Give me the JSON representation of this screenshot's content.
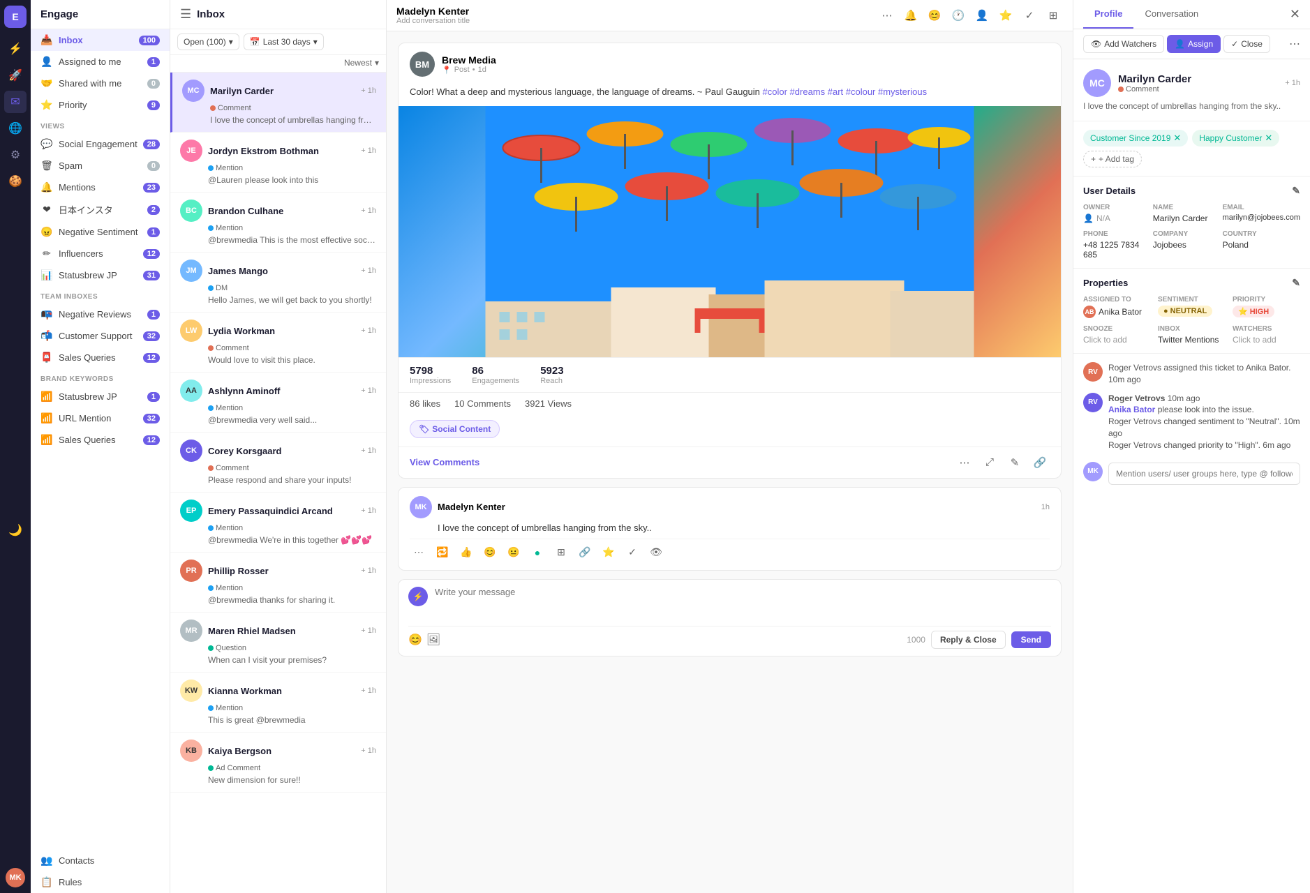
{
  "app": {
    "name": "Engage",
    "logo": "E"
  },
  "iconBar": {
    "items": [
      {
        "name": "navigate-icon",
        "icon": "⚡",
        "active": false
      },
      {
        "name": "rocket-icon",
        "icon": "🚀",
        "active": false
      },
      {
        "name": "inbox-icon",
        "icon": "✉",
        "active": true
      },
      {
        "name": "globe-icon",
        "icon": "🌐",
        "active": false
      },
      {
        "name": "settings-icon",
        "icon": "⚙",
        "active": false
      },
      {
        "name": "cookie-icon",
        "icon": "🍪",
        "active": false
      },
      {
        "name": "moon-icon",
        "icon": "🌙",
        "active": false
      }
    ],
    "avatar": "MK"
  },
  "sidebar": {
    "header": "Engage",
    "mainItems": [
      {
        "label": "Inbox",
        "icon": "📥",
        "badge": "100",
        "badgeColor": "purple",
        "active": true
      },
      {
        "label": "Assigned to me",
        "icon": "👤",
        "badge": "1",
        "badgeColor": "purple"
      },
      {
        "label": "Shared with me",
        "icon": "🤝",
        "badge": "0",
        "badgeColor": "gray"
      },
      {
        "label": "Priority",
        "icon": "⭐",
        "badge": "9",
        "badgeColor": "purple"
      }
    ],
    "viewsLabel": "VIEWS",
    "viewItems": [
      {
        "label": "Social Engagement",
        "icon": "💬",
        "badge": "28"
      },
      {
        "label": "Spam",
        "icon": "🗑",
        "badge": "0"
      },
      {
        "label": "Mentions",
        "icon": "🔔",
        "badge": "23"
      },
      {
        "label": "日本インスタ",
        "icon": "❤",
        "badge": "2"
      },
      {
        "label": "Negative Sentiment",
        "icon": "😠",
        "badge": "1"
      },
      {
        "label": "Influencers",
        "icon": "✏",
        "badge": "12"
      },
      {
        "label": "Statusbrew JP",
        "icon": "📊",
        "badge": "31"
      }
    ],
    "teamInboxLabel": "TEAM INBOXES",
    "teamItems": [
      {
        "label": "Negative Reviews",
        "icon": "📭",
        "badge": "1"
      },
      {
        "label": "Customer Support",
        "icon": "📬",
        "badge": "32"
      },
      {
        "label": "Sales Queries",
        "icon": "📮",
        "badge": "12"
      }
    ],
    "brandLabel": "BRAND KEYWORDS",
    "brandItems": [
      {
        "label": "Statusbrew JP",
        "icon": "📶",
        "badge": "1"
      },
      {
        "label": "URL Mention",
        "icon": "📶",
        "badge": "32"
      },
      {
        "label": "Sales Queries",
        "icon": "📶",
        "badge": "12"
      }
    ],
    "bottomItems": [
      {
        "label": "Contacts",
        "icon": "👥"
      },
      {
        "label": "Rules",
        "icon": "📋"
      }
    ]
  },
  "inbox": {
    "title": "Inbox",
    "filterOpen": "Open (100)",
    "filterDate": "Last 30 days",
    "sortLabel": "Newest",
    "items": [
      {
        "name": "Marilyn Carder",
        "type": "Comment",
        "typeColor": "#e17055",
        "time": "+ 1h",
        "preview": "I love the concept of umbrellas hanging from the sky...",
        "avatarBg": "#a29bfe",
        "initials": "MC",
        "active": true
      },
      {
        "name": "Jordyn Ekstrom Bothman",
        "type": "Mention",
        "typeColor": "#1da1f2",
        "time": "+ 1h",
        "preview": "@Lauren please look into this",
        "avatarBg": "#fd79a8",
        "initials": "JE"
      },
      {
        "name": "Brandon Culhane",
        "type": "Mention",
        "typeColor": "#1da1f2",
        "time": "+ 1h",
        "preview": "@brewmedia This is the most effective social media tips for...",
        "avatarBg": "#55efc4",
        "initials": "BC"
      },
      {
        "name": "James Mango",
        "type": "DM",
        "typeColor": "#1da1f2",
        "time": "+ 1h",
        "preview": "Hello James, we will get back to you shortly!",
        "avatarBg": "#74b9ff",
        "initials": "JM"
      },
      {
        "name": "Lydia Workman",
        "type": "Comment",
        "typeColor": "#e17055",
        "time": "+ 1h",
        "preview": "Would love to visit this place.",
        "avatarBg": "#fdcb6e",
        "initials": "LW"
      },
      {
        "name": "Ashlynn Aminoff",
        "type": "Mention",
        "typeColor": "#1da1f2",
        "time": "+ 1h",
        "preview": "@brewmedia very well said...",
        "avatarBg": "#81ecec",
        "initials": "AA"
      },
      {
        "name": "Corey Korsgaard",
        "type": "Comment",
        "typeColor": "#e17055",
        "time": "+ 1h",
        "preview": "Please respond and share your inputs!",
        "avatarBg": "#6c5ce7",
        "initials": "CK"
      },
      {
        "name": "Emery Passaquindici Arcand",
        "type": "Mention",
        "typeColor": "#1da1f2",
        "time": "+ 1h",
        "preview": "@brewmedia We're in this together 💕💕💕",
        "avatarBg": "#00cec9",
        "initials": "EP"
      },
      {
        "name": "Phillip Rosser",
        "type": "Mention",
        "typeColor": "#1da1f2",
        "time": "+ 1h",
        "preview": "@brewmedia thanks for sharing it.",
        "avatarBg": "#e17055",
        "initials": "PR"
      },
      {
        "name": "Maren Rhiel Madsen",
        "type": "Question",
        "typeColor": "#00b894",
        "time": "+ 1h",
        "preview": "When can I visit your premises?",
        "avatarBg": "#b2bec3",
        "initials": "MR"
      },
      {
        "name": "Kianna Workman",
        "type": "Mention",
        "typeColor": "#1da1f2",
        "time": "+ 1h",
        "preview": "This is great @brewmedia",
        "avatarBg": "#ffeaa7",
        "initials": "KW"
      },
      {
        "name": "Kaiya Bergson",
        "type": "Ad Comment",
        "typeColor": "#00b894",
        "time": "+ 1h",
        "preview": "New dimension for sure!!",
        "avatarBg": "#fab1a0",
        "initials": "KB"
      }
    ]
  },
  "conversation": {
    "headerName": "Madelyn Kenter",
    "headerSub": "Add conversation title",
    "post": {
      "source": "Brew Media",
      "sourceType": "Post",
      "sourceMeta": "1d",
      "avatarBg": "#636e72",
      "avatarInitials": "BM",
      "text": "Color! What a deep and mysterious language, the language of dreams. ~ Paul Gauguin",
      "hashtags": [
        "#color",
        "#dreams",
        "#art",
        "#colour",
        "#mysterious"
      ],
      "stats": {
        "impressions": "5798",
        "impressionsLabel": "Impressions",
        "engagements": "86",
        "engagementsLabel": "Engagements",
        "reach": "5923",
        "reachLabel": "Reach"
      },
      "likes": "86 likes",
      "comments": "10 Comments",
      "views": "3921 Views",
      "tagLabel": "Social Content"
    },
    "comment": {
      "authorName": "Madelyn Kenter",
      "authorAvatarBg": "#a29bfe",
      "authorInitials": "MK",
      "time": "1h",
      "text": "I love the concept of umbrellas hanging from the sky.."
    },
    "compose": {
      "placeholder": "Write your message",
      "charCount": "1000",
      "replyCloseLabel": "Reply & Close",
      "sendLabel": "Send"
    }
  },
  "rightPanel": {
    "tabs": [
      {
        "label": "Profile",
        "active": true
      },
      {
        "label": "Conversation",
        "active": false
      }
    ],
    "actions": {
      "addWatchers": "Add Watchers",
      "assign": "Assign",
      "close": "Close"
    },
    "profile": {
      "name": "Marilyn Carder",
      "type": "Comment",
      "typeColor": "#e17055",
      "avatarBg": "#a29bfe",
      "initials": "MC",
      "badge": "+ 1h",
      "preview": "I love the concept of umbrellas hanging from the sky.."
    },
    "tags": [
      {
        "label": "Customer Since 2019",
        "style": "teal"
      },
      {
        "label": "Happy Customer",
        "style": "green"
      }
    ],
    "addTagLabel": "+ Add tag",
    "userDetails": {
      "title": "User Details",
      "fields": {
        "owner": {
          "label": "OWNER",
          "value": "N/A"
        },
        "name": {
          "label": "NAME",
          "value": "Marilyn Carder"
        },
        "email": {
          "label": "EMAIL",
          "value": "marilyn@jojobees.com"
        },
        "phone": {
          "label": "PHONE",
          "value": "+48 1225 7834 685"
        },
        "company": {
          "label": "COMPANY",
          "value": "Jojobees"
        },
        "country": {
          "label": "COUNTRY",
          "value": "Poland"
        }
      }
    },
    "properties": {
      "title": "Properties",
      "fields": {
        "assignedTo": {
          "label": "ASSIGNED TO",
          "value": "Anika Bator"
        },
        "sentiment": {
          "label": "SENTIMENT",
          "value": "NEUTRAL"
        },
        "priority": {
          "label": "PRIORITY",
          "value": "HIGH"
        },
        "snooze": {
          "label": "SNOOZE",
          "value": "Click to add"
        },
        "inbox": {
          "label": "INBOX",
          "value": "Twitter Mentions"
        },
        "watchers": {
          "label": "WATCHERS",
          "value": "Click to add"
        }
      }
    },
    "activity": [
      {
        "text": "Roger Vetrovs assigned this ticket to Anika Bator. 10m ago",
        "avatarBg": "#e17055",
        "initials": "RV"
      },
      {
        "name": "Roger Vetrovs",
        "time": "10m ago",
        "lines": [
          "Anika Bator please look into the issue.",
          "Roger Vetrovs changed sentiment to \"Neutral\". 10m ago",
          "Roger Vetrovs changed priority to \"High\". 6m ago"
        ],
        "avatarBg": "#6c5ce7",
        "initials": "RV"
      }
    ],
    "activityInputPlaceholder": "Mention users/ user groups here, type @ followed by their name"
  }
}
